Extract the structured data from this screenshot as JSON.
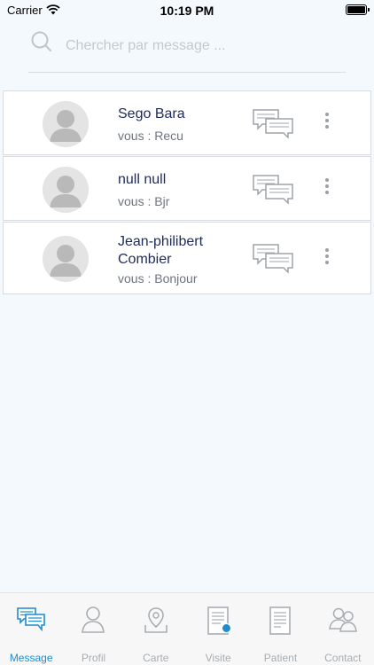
{
  "status_bar": {
    "carrier": "Carrier",
    "time": "10:19 PM"
  },
  "search": {
    "placeholder": "Chercher par message ..."
  },
  "conversations": [
    {
      "name": "Sego Bara",
      "preview": "vous : Recu"
    },
    {
      "name": "null null",
      "preview": "vous : Bjr"
    },
    {
      "name": "Jean-philibert Combier",
      "preview": "vous : Bonjour"
    }
  ],
  "tabs": [
    {
      "label": "Message",
      "icon": "message-icon",
      "active": true
    },
    {
      "label": "Profil",
      "icon": "profile-icon",
      "active": false
    },
    {
      "label": "Carte",
      "icon": "map-icon",
      "active": false
    },
    {
      "label": "Visite",
      "icon": "document-icon",
      "active": false
    },
    {
      "label": "Patient",
      "icon": "patient-file-icon",
      "active": false
    },
    {
      "label": "Contact",
      "icon": "contacts-icon",
      "active": false
    }
  ],
  "colors": {
    "accent": "#1f8ccd",
    "inactive": "#a8adb2",
    "name": "#1f2a5a"
  }
}
